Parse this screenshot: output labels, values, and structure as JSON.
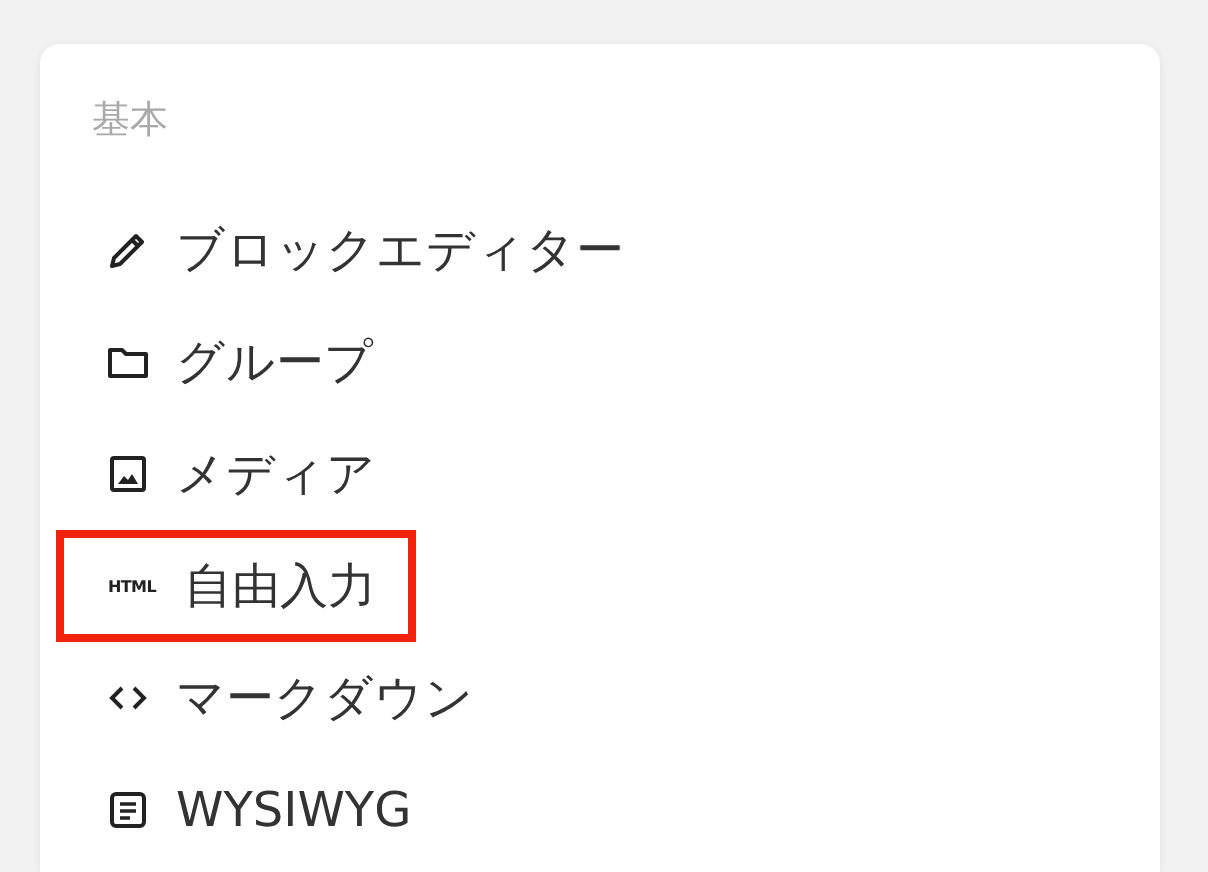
{
  "menu": {
    "heading": "基本",
    "items": [
      {
        "label": "ブロックエディター",
        "highlighted": false
      },
      {
        "label": "グループ",
        "highlighted": false
      },
      {
        "label": "メディア",
        "highlighted": false
      },
      {
        "icon_text": "HTML",
        "label": "自由入力",
        "highlighted": true
      },
      {
        "label": "マークダウン",
        "highlighted": false
      },
      {
        "label": "WYSIWYG",
        "highlighted": false
      }
    ]
  }
}
